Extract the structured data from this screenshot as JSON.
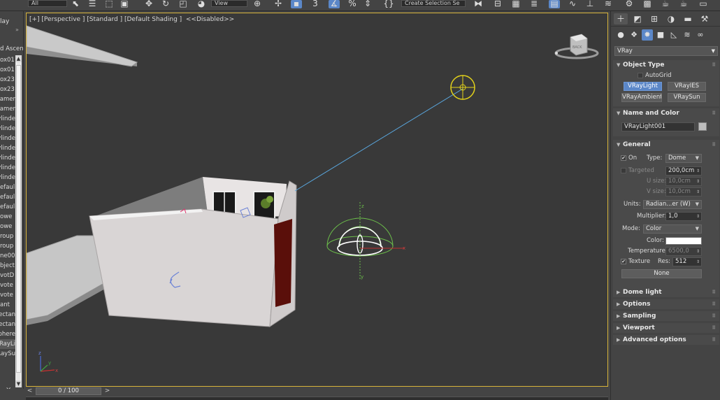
{
  "toolbar": {
    "selection_filter": "All",
    "view_dropdown": "View",
    "snap_value": "3",
    "named_selection": "Create Selection Se"
  },
  "explorer": {
    "title": "lay",
    "header": "d Ascend",
    "items": [
      "ox01",
      "ox01",
      "ox23",
      "ox23",
      "amer",
      "amer",
      "ylinde",
      "ylinde",
      "ylinde",
      "ylinde",
      "ylinde",
      "ylinde",
      "ylinde",
      "efaul",
      "efaul",
      "efaul",
      "owe",
      "owe",
      "roup",
      "roup",
      "ne00",
      "bject",
      "votD",
      "vote",
      "vote",
      "ant",
      "ectan",
      "ectan",
      "phere",
      "RayLi",
      "RaySu"
    ],
    "selected_index": 29,
    "bottom_close": "×"
  },
  "viewport": {
    "label": "[+] [Perspective ] [Standard ] [Default Shading ]  <<Disabled>>",
    "viewcube_text": "BACK",
    "gizmo_axes": [
      "x",
      "y",
      "z"
    ],
    "axis_tripod": [
      "x",
      "y",
      "z"
    ]
  },
  "timeline": {
    "prev": "<",
    "frame_text": "0 / 100",
    "next": ">"
  },
  "command_panel": {
    "category_dropdown": "VRay",
    "object_type": {
      "title": "Object Type",
      "autogrid": "AutoGrid",
      "buttons": [
        "VRayLight",
        "VRayIES",
        "VRayAmbientLight",
        "VRaySun"
      ],
      "active_button": "VRayLight"
    },
    "name_color": {
      "title": "Name and Color",
      "name": "VRayLight001"
    },
    "general": {
      "title": "General",
      "on_label": "On",
      "on_checked": true,
      "type_label": "Type:",
      "type_value": "Dome",
      "targeted_label": "Targeted",
      "target_distance": "200,0cm",
      "u_size_label": "U size:",
      "u_size": "10,0cm",
      "v_size_label": "V size:",
      "v_size": "10,0cm",
      "units_label": "Units:",
      "units_value": "Radian...er (W)",
      "multiplier_label": "Multiplier:",
      "multiplier": "1,0",
      "mode_label": "Mode:",
      "mode_value": "Color",
      "color_label": "Color:",
      "light_color": "#ffffff",
      "temperature_label": "Temperature:",
      "temperature": "6500,0",
      "texture_label": "Texture",
      "texture_checked": true,
      "res_label": "Res:",
      "res_value": "512",
      "texture_map": "None"
    },
    "collapsed_rollouts": [
      "Dome light",
      "Options",
      "Sampling",
      "Viewport",
      "Advanced options"
    ]
  },
  "colors": {
    "viewport_border": "#d8b43b",
    "selected_button": "#5b87c8",
    "light_target": "#e3d21a",
    "light_line": "#5aa8e0",
    "dome_gizmo": "#6cbf4a"
  }
}
